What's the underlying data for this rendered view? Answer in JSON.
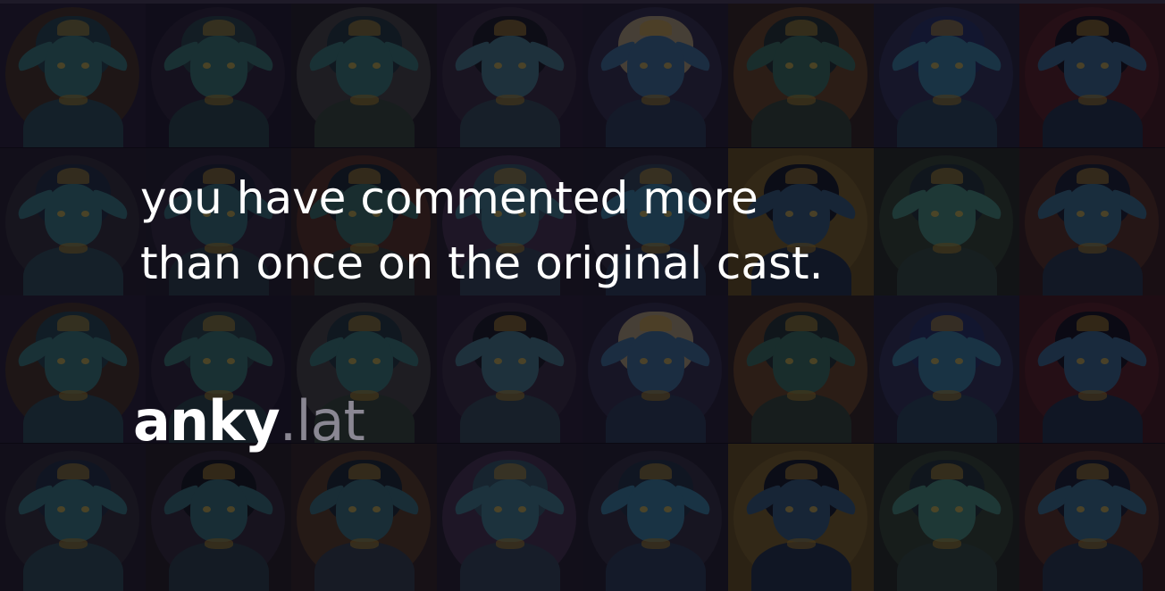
{
  "message": {
    "line1": "you have commented more",
    "line2": "than once on the original cast."
  },
  "logo": {
    "brand": "anky",
    "tld": ".lat"
  },
  "background": {
    "description_rows": 4,
    "description_cols": 8,
    "tiles": [
      {
        "bg": "#1f1a2e",
        "halo": "#3a2a1e",
        "skin": "#2e6a6a",
        "hair": "#1b3a44",
        "cloth": "#22414a"
      },
      {
        "bg": "#181526",
        "halo": "#241d30",
        "skin": "#2f6662",
        "hair": "#213a3e",
        "cloth": "#1f3b3f"
      },
      {
        "bg": "#1c1a20",
        "halo": "#3a3a3a",
        "skin": "#2e6966",
        "hair": "#1a2e36",
        "cloth": "#2c3c30"
      },
      {
        "bg": "#231a2e",
        "halo": "#2e2438",
        "skin": "#3a6a78",
        "hair": "#12141e",
        "cloth": "#2a3f4a"
      },
      {
        "bg": "#1d1a2c",
        "halo": "#2a2640",
        "skin": "#345f84",
        "hair": "#9a8a6a",
        "cloth": "#23324a"
      },
      {
        "bg": "#2a1e1a",
        "halo": "#5a3a1e",
        "skin": "#2e6052",
        "hair": "#1a2a2a",
        "cloth": "#2a3a2e"
      },
      {
        "bg": "#1e1e34",
        "halo": "#262a4a",
        "skin": "#2f6f8a",
        "hair": "#1e2a5a",
        "cloth": "#1f3a4e"
      },
      {
        "bg": "#3a1418",
        "halo": "#4a1a1e",
        "skin": "#2f5a7a",
        "hair": "#0e0e18",
        "cloth": "#1a2a3e"
      },
      {
        "bg": "#1d1a26",
        "halo": "#2a2630",
        "skin": "#2e6a70",
        "hair": "#18283a",
        "cloth": "#24404a"
      },
      {
        "bg": "#1c1828",
        "halo": "#2a2236",
        "skin": "#2c5f66",
        "hair": "#161e2e",
        "cloth": "#22363e"
      },
      {
        "bg": "#2a1e1e",
        "halo": "#4a2a1e",
        "skin": "#2e5f5a",
        "hair": "#12202a",
        "cloth": "#2a3632"
      },
      {
        "bg": "#1e1a28",
        "halo": "#3a2a44",
        "skin": "#356c7a",
        "hair": "#2a4a5a",
        "cloth": "#2a3a4a"
      },
      {
        "bg": "#1c1a26",
        "halo": "#2a2638",
        "skin": "#2e6f8a",
        "hair": "#283a4a",
        "cloth": "#22344a"
      },
      {
        "bg": "#5a4618",
        "halo": "#6a5420",
        "skin": "#2a4e6a",
        "hair": "#0e1420",
        "cloth": "#1a2a3e"
      },
      {
        "bg": "#1e241e",
        "halo": "#2a3a2a",
        "skin": "#3a7a6a",
        "hair": "#1a2a2e",
        "cloth": "#2a3e36"
      },
      {
        "bg": "#2e1a18",
        "halo": "#4a2a1e",
        "skin": "#2e607a",
        "hair": "#12182a",
        "cloth": "#1e2e42"
      },
      {
        "bg": "#1f1a2e",
        "halo": "#3a2a1e",
        "skin": "#2e6a6a",
        "hair": "#1b3a44",
        "cloth": "#22414a"
      },
      {
        "bg": "#181526",
        "halo": "#241d30",
        "skin": "#2f6662",
        "hair": "#213a3e",
        "cloth": "#1f3b3f"
      },
      {
        "bg": "#1c1a20",
        "halo": "#3a3a3a",
        "skin": "#2e6966",
        "hair": "#1a2e36",
        "cloth": "#2c3c30"
      },
      {
        "bg": "#231a2e",
        "halo": "#2e2438",
        "skin": "#3a6a78",
        "hair": "#12141e",
        "cloth": "#2a3f4a"
      },
      {
        "bg": "#1d1a2c",
        "halo": "#2a2640",
        "skin": "#345f84",
        "hair": "#9a8a6a",
        "cloth": "#23324a"
      },
      {
        "bg": "#2a1e1a",
        "halo": "#5a3a1e",
        "skin": "#2e6052",
        "hair": "#1a2a2a",
        "cloth": "#2a3a2e"
      },
      {
        "bg": "#1e1e34",
        "halo": "#262a4a",
        "skin": "#2f6f8a",
        "hair": "#1e2a5a",
        "cloth": "#1f3a4e"
      },
      {
        "bg": "#3a1418",
        "halo": "#4a1a1e",
        "skin": "#2f5a7a",
        "hair": "#0e0e18",
        "cloth": "#1a2a3e"
      },
      {
        "bg": "#1d1a26",
        "halo": "#2a2630",
        "skin": "#2e6a70",
        "hair": "#18283a",
        "cloth": "#24404a"
      },
      {
        "bg": "#1e1a1e",
        "halo": "#2a2230",
        "skin": "#2c5f66",
        "hair": "#0e121a",
        "cloth": "#22363e"
      },
      {
        "bg": "#2a1e1e",
        "halo": "#4a321e",
        "skin": "#2e5f6a",
        "hair": "#12202a",
        "cloth": "#2a3642"
      },
      {
        "bg": "#1e1a28",
        "halo": "#3a2a44",
        "skin": "#356c7a",
        "hair": "#2a4a5a",
        "cloth": "#2a3a4a"
      },
      {
        "bg": "#1c1a26",
        "halo": "#2a2638",
        "skin": "#2e6f8a",
        "hair": "#1a2a3a",
        "cloth": "#22344a"
      },
      {
        "bg": "#5a4618",
        "halo": "#6a5420",
        "skin": "#2a4e6a",
        "hair": "#0e1420",
        "cloth": "#1a2a3e"
      },
      {
        "bg": "#1e241e",
        "halo": "#2a3a2a",
        "skin": "#3a7a6a",
        "hair": "#1a2a2e",
        "cloth": "#2a3e36"
      },
      {
        "bg": "#2e1a18",
        "halo": "#4a2a1e",
        "skin": "#2e607a",
        "hair": "#12182a",
        "cloth": "#1e2e42"
      }
    ]
  }
}
